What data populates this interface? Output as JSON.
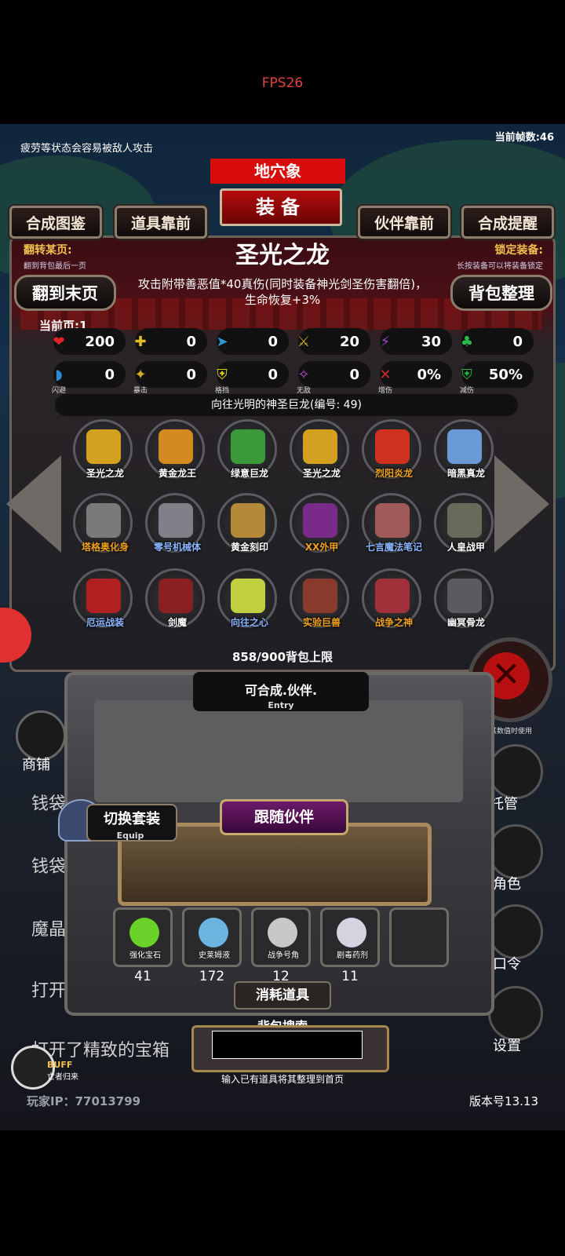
{
  "fps": "FPS26",
  "status_message": "疲劳等状态会容易被敌人攻击",
  "frame_count": "当前帧数:46",
  "zone_label": "地穴象",
  "equip_title": "装备",
  "top_tabs": [
    "合成图鉴",
    "道具靠前",
    "伙伴靠前",
    "合成提醒"
  ],
  "flip_label": "翻转某页:",
  "flip_hint": "翻到背包最后一页",
  "lock_label": "锁定装备:",
  "lock_hint": "长按装备可以将装备锁定",
  "item_title": "圣光之龙",
  "to_last_page": "翻到末页",
  "bag_sort": "背包整理",
  "description": "攻击附带善恶值*40真伤(同时装备神光剑圣伤害翻倍)，生命恢复+3%",
  "current_page": "当前页:1",
  "stats_row1": [
    {
      "icon": "heart-icon",
      "glyph": "❤",
      "color": "#e02424",
      "value": "200",
      "label": ""
    },
    {
      "icon": "armor-icon",
      "glyph": "✚",
      "color": "#e0c020",
      "value": "0",
      "label": ""
    },
    {
      "icon": "boot-icon",
      "glyph": "➤",
      "color": "#2a9ad6",
      "value": "0",
      "label": ""
    },
    {
      "icon": "sword-icon",
      "glyph": "⚔",
      "color": "#d4a82a",
      "value": "20",
      "label": ""
    },
    {
      "icon": "lightning-icon",
      "glyph": "⚡",
      "color": "#9a48d6",
      "value": "30",
      "label": ""
    },
    {
      "icon": "clover-icon",
      "glyph": "♣",
      "color": "#2ab84a",
      "value": "0",
      "label": ""
    }
  ],
  "stats_row2": [
    {
      "icon": "dodge-icon",
      "glyph": "◗",
      "color": "#2a8ad6",
      "value": "0",
      "label": "闪避"
    },
    {
      "icon": "critical-icon",
      "glyph": "✦",
      "color": "#d4a82a",
      "value": "0",
      "label": "暴击"
    },
    {
      "icon": "shield-icon",
      "glyph": "⛨",
      "color": "#e0d020",
      "value": "0",
      "label": "格挡"
    },
    {
      "icon": "wings-icon",
      "glyph": "✧",
      "color": "#c040d6",
      "value": "0",
      "label": "无敌"
    },
    {
      "icon": "crossed-swords-icon",
      "glyph": "✕",
      "color": "#d02828",
      "value": "0%",
      "label": "增伤"
    },
    {
      "icon": "green-shield-icon",
      "glyph": "⛨",
      "color": "#2ab84a",
      "value": "50%",
      "label": "减伤"
    }
  ],
  "dragon_name": "向往光明的神圣巨龙(编号: 49)",
  "items": [
    {
      "name": "圣光之龙",
      "color": "#d4a020",
      "name_color": "#ffffff"
    },
    {
      "name": "黄金龙王",
      "color": "#d48a20",
      "name_color": "#ffffff"
    },
    {
      "name": "绿意巨龙",
      "color": "#3a9a3a",
      "name_color": "#ffffff"
    },
    {
      "name": "圣光之龙",
      "color": "#d4a020",
      "name_color": "#ffffff"
    },
    {
      "name": "烈阳炎龙",
      "color": "#d0301e",
      "name_color": "#f0a020"
    },
    {
      "name": "暗黑真龙",
      "color": "#6a9ad6",
      "name_color": "#ffffff"
    },
    {
      "name": "塔格奥化身",
      "color": "#7a7a7a",
      "name_color": "#f0a020"
    },
    {
      "name": "零号机械体",
      "color": "#808088",
      "name_color": "#8ab4ff"
    },
    {
      "name": "黄金刻印",
      "color": "#b48a3a",
      "name_color": "#ffffff"
    },
    {
      "name": "XX外甲",
      "color": "#7a2a8a",
      "name_color": "#f0a020"
    },
    {
      "name": "七言魔法笔记",
      "color": "#a05a5a",
      "name_color": "#8ab4ff"
    },
    {
      "name": "人皇战甲",
      "color": "#6a6a5a",
      "name_color": "#ffffff"
    },
    {
      "name": "厄运战装",
      "color": "#b02020",
      "name_color": "#8ab4ff"
    },
    {
      "name": "剑魔",
      "color": "#8a2020",
      "name_color": "#ffffff"
    },
    {
      "name": "向往之心",
      "color": "#c0d040",
      "name_color": "#8ab4ff"
    },
    {
      "name": "实验巨兽",
      "color": "#8a3a2a",
      "name_color": "#f0a020"
    },
    {
      "name": "战争之神",
      "color": "#a0303a",
      "name_color": "#f0a020"
    },
    {
      "name": "幽冥骨龙",
      "color": "#5a5a60",
      "name_color": "#ffffff"
    }
  ],
  "bag_limit": "858/900背包上限",
  "craft_text": "可合成.伙伴.",
  "entry_text": "Entry",
  "switch_outfit": "切换套装",
  "switch_sub": "Equip",
  "follow_partner": "跟随伙伴",
  "consumables": [
    {
      "name": "强化宝石",
      "count": "41",
      "color": "#6ad02a"
    },
    {
      "name": "史莱姆液",
      "count": "172",
      "color": "#6ab4e0"
    },
    {
      "name": "战争号角",
      "count": "12",
      "color": "#c8c8c8"
    },
    {
      "name": "剧毒药剂",
      "count": "11",
      "color": "#d4d4e0"
    },
    {
      "name": "",
      "count": "",
      "color": "#2a2a2c"
    }
  ],
  "consume_label": "消耗道具",
  "search_label": "背包搜索",
  "search_value": "",
  "search_hint": "输入已有道具将其整理到首页",
  "player_ip": "玩家IP：77013799",
  "version": "版本号13.13",
  "shop_label": "商铺",
  "right_buttons": [
    "托管",
    "角色",
    "口令",
    "设置"
  ],
  "right_small_text": "其数值时使用",
  "background_texts": [
    "钱袋",
    "钱袋子",
    "魔晶",
    "打开",
    "打开了精致的宝箱"
  ],
  "buff_label": "BUFF",
  "buff_sub": "亡者归来"
}
